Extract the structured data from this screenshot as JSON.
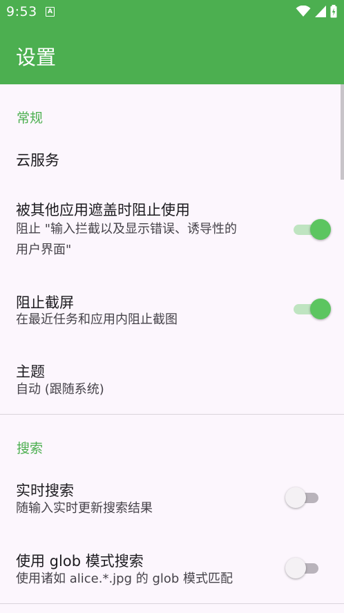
{
  "status_bar": {
    "time": "9:53",
    "notification_glyph": "A"
  },
  "app_bar": {
    "title": "设置"
  },
  "sections": {
    "general": {
      "header": "常规",
      "cloud": {
        "title": "云服务"
      },
      "block_overlay": {
        "title": "被其他应用遮盖时阻止使用",
        "summary_line1": "阻止 \"输入拦截以及显示错误、诱导性的",
        "summary_line2": "用户界面\"",
        "enabled": true
      },
      "block_screenshot": {
        "title": "阻止截屏",
        "summary": "在最近任务和应用内阻止截图",
        "enabled": true
      },
      "theme": {
        "title": "主题",
        "summary": "自动 (跟随系统)"
      }
    },
    "search": {
      "header": "搜索",
      "realtime": {
        "title": "实时搜索",
        "summary": "随输入实时更新搜索结果",
        "enabled": false
      },
      "glob": {
        "title": "使用 glob 模式搜索",
        "summary": "使用诸如 alice.*.jpg 的 glob 模式匹配",
        "enabled": false
      }
    }
  },
  "colors": {
    "accent": "#4caf50",
    "background": "#fcf6fd"
  }
}
